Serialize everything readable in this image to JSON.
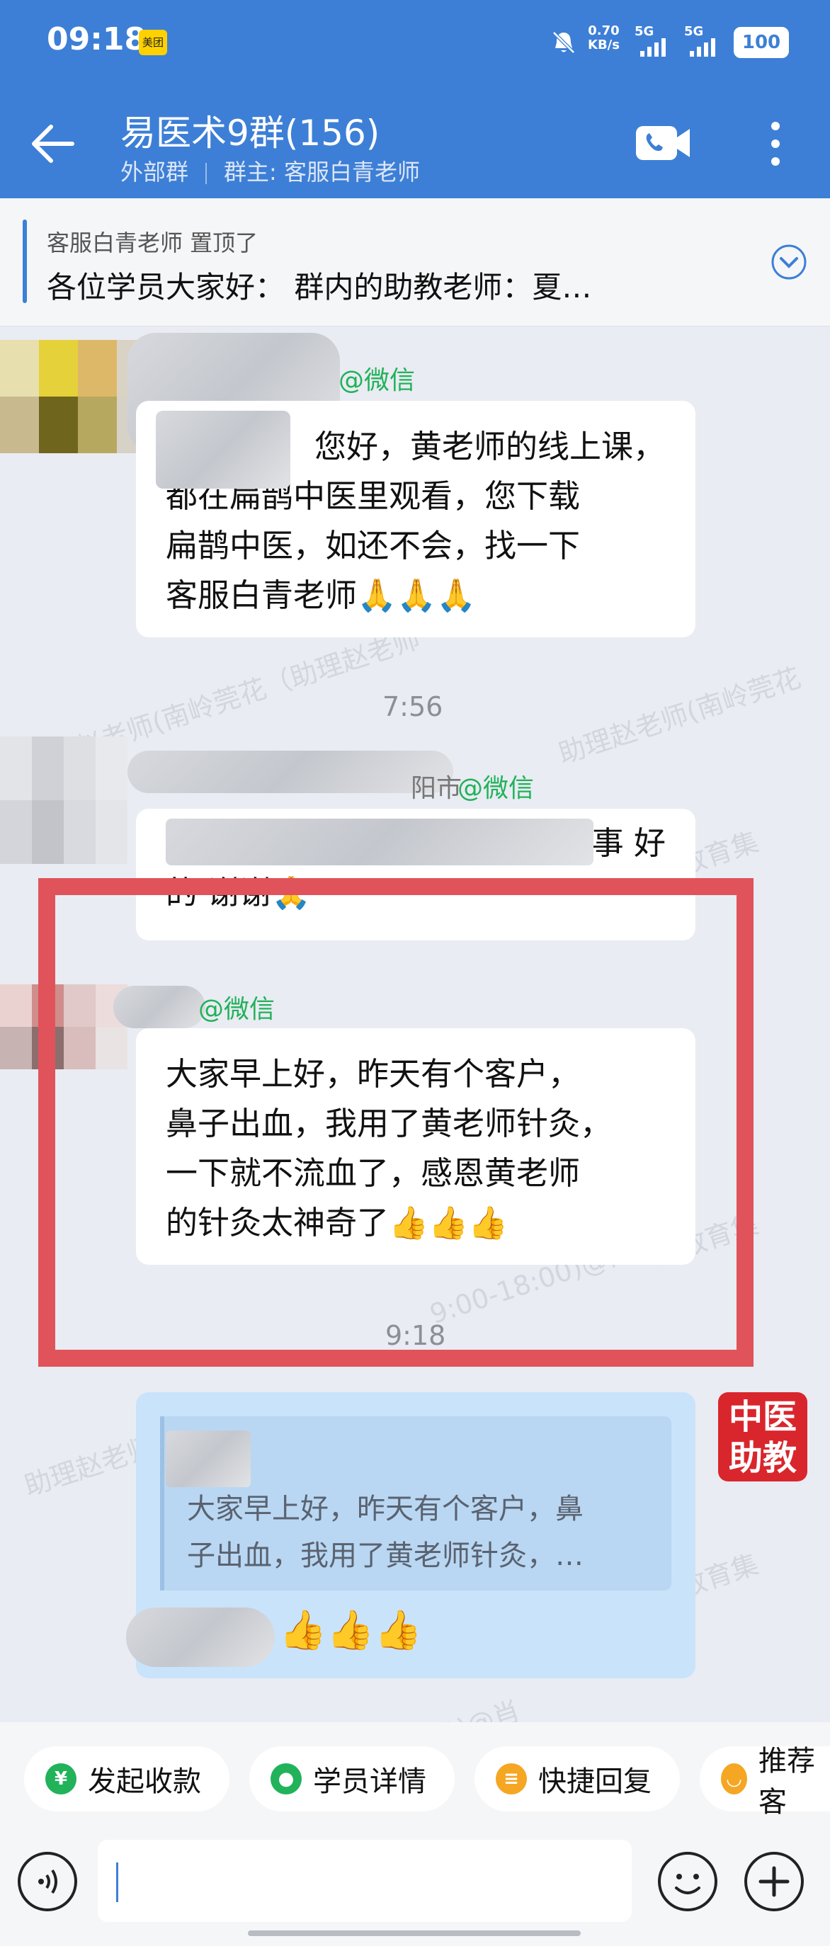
{
  "status_bar": {
    "time": "09:18",
    "app_badge": "美团",
    "speed_value": "0.70",
    "speed_unit": "KB/s",
    "sim1": "5G",
    "sim2": "5G",
    "battery": "100"
  },
  "header": {
    "title": "易医术9群(156)",
    "group_type": "外部群",
    "owner": "群主: 客服白青老师"
  },
  "pinned": {
    "author": "客服白青老师 置顶了",
    "text": "各位学员大家好：  群内的助教老师：夏…"
  },
  "messages": [
    {
      "sender_suffix": "@微信",
      "lines": [
        "您好，黄老师的线上课，",
        "都在扁鹊中医里观看，您下载",
        "扁鹊中医，如还不会，找一下",
        "客服白青老师🙏🙏🙏"
      ]
    },
    {
      "timestamp": "7:56"
    },
    {
      "sender_visible": "阳市",
      "sender_suffix": "@微信",
      "line1_end": "事 好",
      "line2": "的  谢谢🙏"
    },
    {
      "sender_suffix": "@微信",
      "lines": [
        "大家早上好，昨天有个客户，",
        "鼻子出血，我用了黄老师针灸，",
        "一下就不流血了，感恩黄老师",
        "的针灸太神奇了👍👍👍"
      ]
    },
    {
      "timestamp": "9:18"
    }
  ],
  "own_message": {
    "quote_lines": [
      "大家早上好，昨天有个客户，鼻",
      "子出血，我用了黄老师针灸，…"
    ],
    "reply": "👍👍👍",
    "badge_line1": "中医",
    "badge_line2": "助教"
  },
  "watermarks": [
    "助理赵老师(南岭莞花（助理赵老师",
    "助理赵老师(南岭莞花",
    "诚教育集",
    "9:00-18:00)@南",
    "9:00-18:00)@肖",
    "助理赵老师"
  ],
  "quick_actions": [
    {
      "label": "发起收款",
      "icon": "payment-icon",
      "color": "#21b25a"
    },
    {
      "label": "学员详情",
      "icon": "student-icon",
      "color": "#21b25a"
    },
    {
      "label": "快捷回复",
      "icon": "quick-reply-icon",
      "color": "#f5a623"
    },
    {
      "label": "推荐客",
      "icon": "recommend-icon",
      "color": "#f5a623"
    }
  ],
  "colors": {
    "header": "#3d7fd6",
    "highlight_frame": "#e0535b",
    "own_bubble": "#c9e3fb",
    "badge": "#d9262c"
  }
}
